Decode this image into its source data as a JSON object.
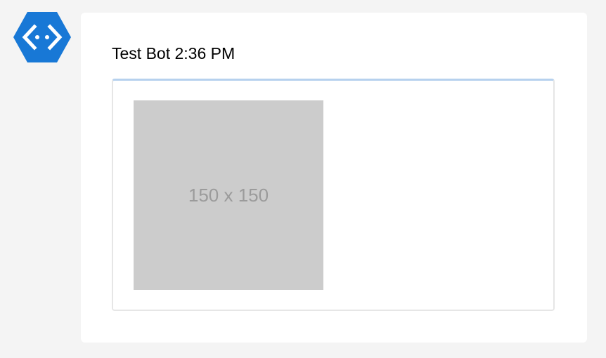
{
  "bot": {
    "name": "Test Bot",
    "timestamp": "2:36 PM",
    "avatar_icon": "bot-framework-icon",
    "avatar_color": "#1a73e8"
  },
  "attachment": {
    "image_placeholder_text": "150 x 150",
    "image_background": "#cccccc",
    "card_accent": "#b6d1ee"
  }
}
